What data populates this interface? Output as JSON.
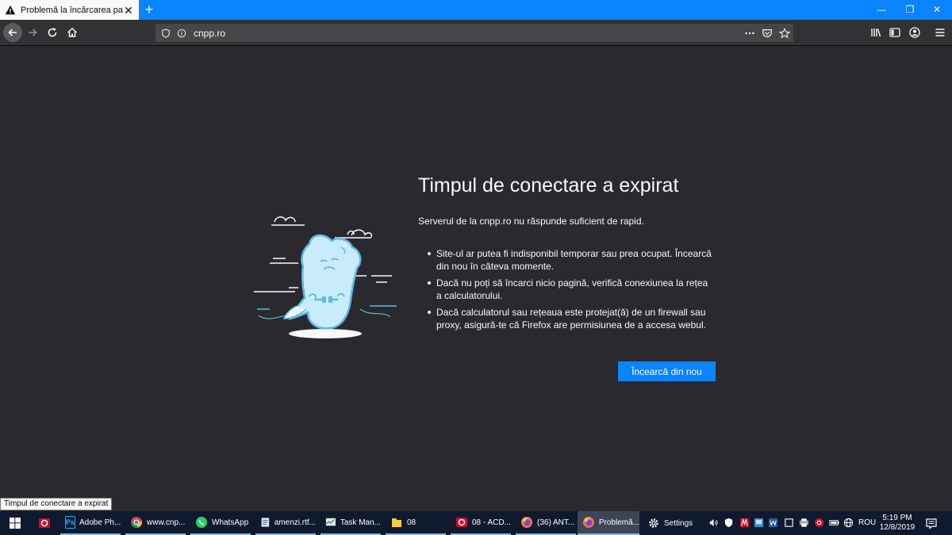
{
  "browser": {
    "tab": {
      "title": "Problemă la încărcarea paginii",
      "close": "✕"
    },
    "new_tab": "+",
    "window_controls": {
      "minimize": "—",
      "restore": "❐",
      "close": "✕"
    },
    "url": "cnpp.ro"
  },
  "error_page": {
    "title": "Timpul de conectare a expirat",
    "short_desc": "Serverul de la cnpp.ro nu răspunde suficient de rapid.",
    "suggestions": [
      "Site-ul ar putea fi indisponibil temporar sau prea ocupat. Încearcă din nou în câteva momente.",
      "Dacă nu poți să încarci nicio pagină, verifică conexiunea la rețea a calculatorului.",
      "Dacă calculatorul sau rețeaua este protejat(ă) de un firewall sau proxy, asigură-te că Firefox are permisiunea de a accesa webul."
    ],
    "retry_button": "Încearcă din nou",
    "accent_color": "#0a84ff"
  },
  "tooltip": "Timpul de conectare a expirat",
  "taskbar": {
    "items": [
      {
        "label": "Adobe Ph...",
        "icon": "photoshop-icon"
      },
      {
        "label": "www.cnp...",
        "icon": "chrome-icon"
      },
      {
        "label": "WhatsApp",
        "icon": "whatsapp-icon"
      },
      {
        "label": "amenzi.rtf...",
        "icon": "document-icon"
      },
      {
        "label": "Task Man...",
        "icon": "task-manager-icon"
      },
      {
        "label": "08",
        "icon": "folder-icon"
      },
      {
        "label": "08 - ACD...",
        "icon": "acdsee-icon"
      },
      {
        "label": "(36) ANT...",
        "icon": "firefox-icon"
      },
      {
        "label": "Problemă...",
        "icon": "firefox-icon"
      },
      {
        "label": "Settings",
        "icon": "gear-icon"
      }
    ],
    "language": "ROU",
    "time": "5:19 PM",
    "date": "12/8/2019"
  }
}
